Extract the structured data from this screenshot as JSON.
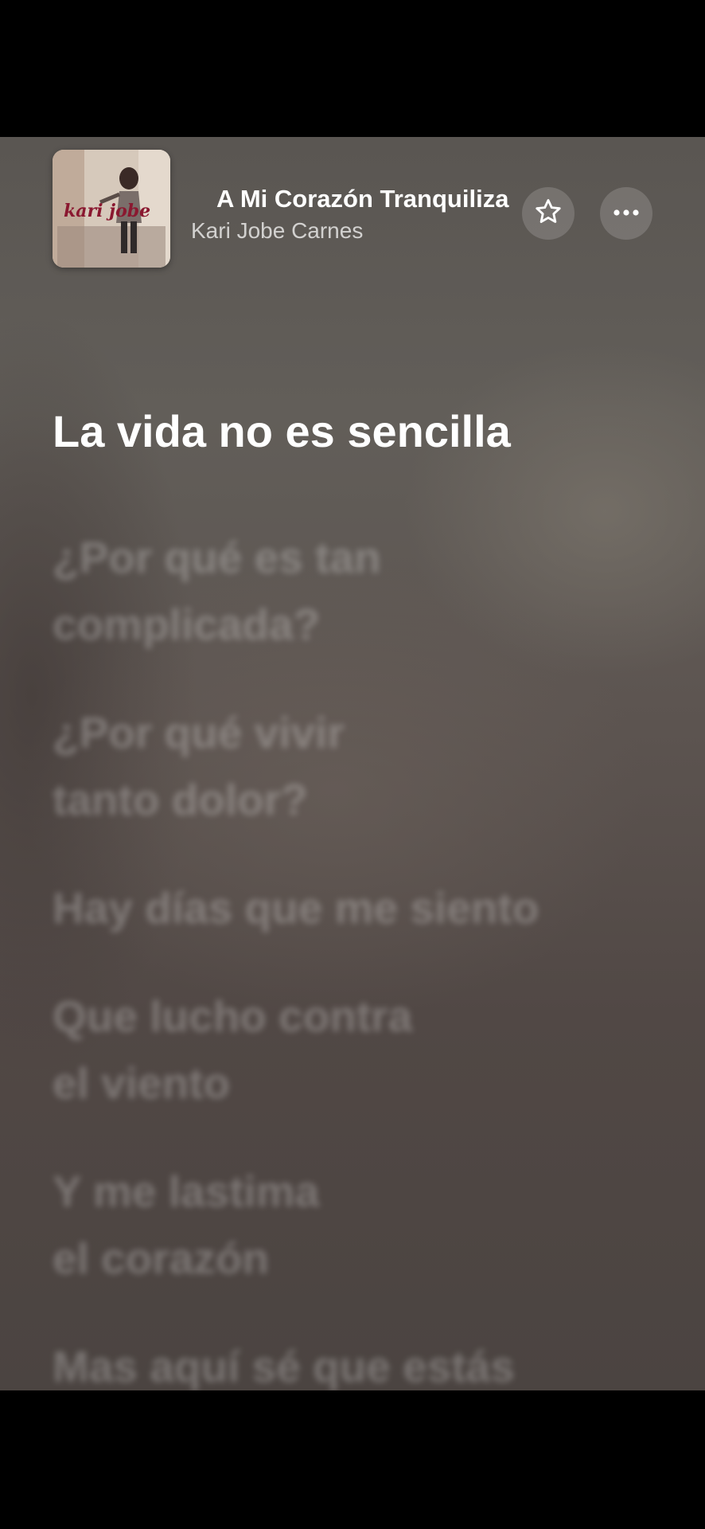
{
  "now_playing": {
    "title": "A Mi Corazón Tranquiliza",
    "artist": "Kari Jobe Carnes",
    "album_art_text": "kari jobe"
  },
  "actions": {
    "favorite_icon": "star-icon",
    "more_icon": "more-icon"
  },
  "lyrics": {
    "active": "La vida no es sencilla",
    "upcoming": [
      "¿Por qué es tan\ncomplicada?",
      "¿Por qué vivir\ntanto dolor?",
      "Hay días que me siento",
      "Que lucho contra\nel viento",
      "Y me lastima\nel corazón",
      "Mas aquí sé que estás"
    ]
  }
}
